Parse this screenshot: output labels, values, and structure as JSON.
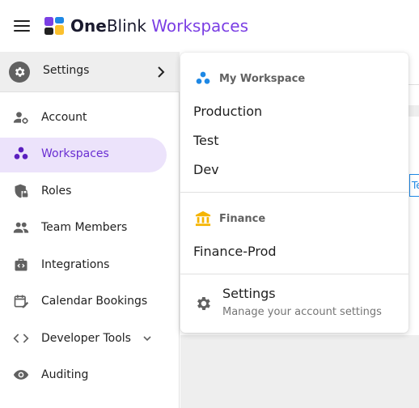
{
  "header": {
    "brand_bold": "One",
    "brand_regular": "Blink",
    "brand_accent": "Workspaces",
    "logo_colors": [
      "#7b3fe4",
      "#1e88e5",
      "#fbc02d",
      "#212121"
    ]
  },
  "sidebar": {
    "settings_label": "Settings",
    "items": [
      {
        "label": "Account",
        "icon": "account-cog-icon"
      },
      {
        "label": "Workspaces",
        "icon": "workspaces-icon",
        "active": true
      },
      {
        "label": "Roles",
        "icon": "shield-lock-icon"
      },
      {
        "label": "Team Members",
        "icon": "people-icon"
      },
      {
        "label": "Integrations",
        "icon": "integration-bag-icon"
      },
      {
        "label": "Calendar Bookings",
        "icon": "calendar-edit-icon"
      },
      {
        "label": "Developer Tools",
        "icon": "code-icon"
      },
      {
        "label": "Auditing",
        "icon": "eye-icon"
      }
    ]
  },
  "content": {
    "tab_fragment": "Te"
  },
  "menu": {
    "workspace_group": {
      "title": "My Workspace",
      "items": [
        "Production",
        "Test",
        "Dev"
      ]
    },
    "finance_group": {
      "title": "Finance",
      "items": [
        "Finance-Prod"
      ]
    },
    "settings": {
      "title": "Settings",
      "subtitle": "Manage your account settings"
    }
  },
  "colors": {
    "accent": "#7b3fe4",
    "active_bg": "#ece3fb",
    "workspace_icon": "#1e88e5",
    "finance_icon": "#f5b400"
  }
}
